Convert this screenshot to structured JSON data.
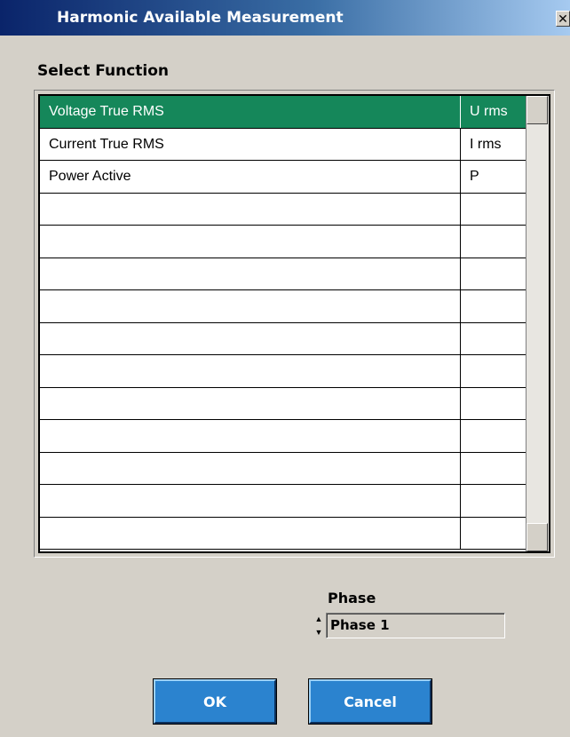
{
  "window": {
    "title": "Harmonic Available Measurement",
    "close_glyph": "✕"
  },
  "section": {
    "label": "Select Function"
  },
  "functions": {
    "rows": [
      {
        "name": "Voltage True RMS",
        "abbr": "U rms",
        "selected": true
      },
      {
        "name": "Current True RMS",
        "abbr": "I rms",
        "selected": false
      },
      {
        "name": "Power Active",
        "abbr": "P",
        "selected": false
      },
      {
        "name": "",
        "abbr": "",
        "selected": false
      },
      {
        "name": "",
        "abbr": "",
        "selected": false
      },
      {
        "name": "",
        "abbr": "",
        "selected": false
      },
      {
        "name": "",
        "abbr": "",
        "selected": false
      },
      {
        "name": "",
        "abbr": "",
        "selected": false
      },
      {
        "name": "",
        "abbr": "",
        "selected": false
      },
      {
        "name": "",
        "abbr": "",
        "selected": false
      },
      {
        "name": "",
        "abbr": "",
        "selected": false
      },
      {
        "name": "",
        "abbr": "",
        "selected": false
      },
      {
        "name": "",
        "abbr": "",
        "selected": false
      },
      {
        "name": "",
        "abbr": "",
        "selected": false
      }
    ]
  },
  "phase": {
    "label": "Phase",
    "value": "Phase 1",
    "spin_up_icon": "▲",
    "spin_down_icon": "▼"
  },
  "buttons": {
    "ok_label": "OK",
    "cancel_label": "Cancel"
  },
  "colors": {
    "title_bar": "#0a246a",
    "selection": "#15875a",
    "button": "#2b83cf",
    "dialog_bg": "#d4d0c8"
  },
  "icons": {
    "close": "close-icon",
    "spin_up": "arrow-up-icon",
    "spin_down": "arrow-down-icon"
  }
}
